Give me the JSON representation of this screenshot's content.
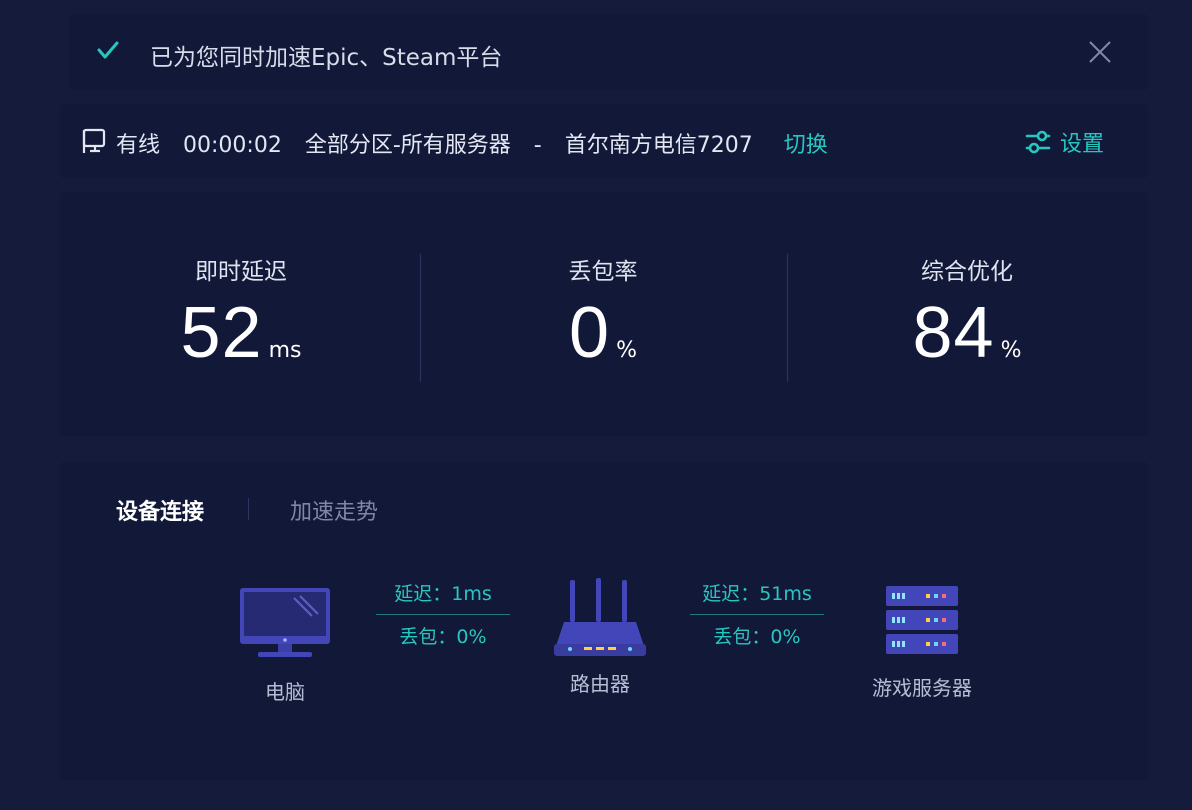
{
  "banner": {
    "message": "已为您同时加速Epic、Steam平台",
    "icons": {
      "check": "check-icon",
      "close": "close-icon"
    }
  },
  "status": {
    "connection_type": "有线",
    "elapsed": "00:00:02",
    "region": "全部分区-所有服务器",
    "separator": "-",
    "server": "首尔南方电信7207",
    "switch_label": "切换",
    "settings_label": "设置"
  },
  "metrics": [
    {
      "label": "即时延迟",
      "value": "52",
      "unit": "ms"
    },
    {
      "label": "丢包率",
      "value": "0",
      "unit": "%"
    },
    {
      "label": "综合优化",
      "value": "84",
      "unit": "%"
    }
  ],
  "tabs": {
    "devices": "设备连接",
    "trend": "加速走势"
  },
  "devices": {
    "pc": "电脑",
    "router": "路由器",
    "server": "游戏服务器"
  },
  "links": [
    {
      "latency": "延迟：1ms",
      "loss": "丢包：0%"
    },
    {
      "latency": "延迟：51ms",
      "loss": "丢包：0%"
    }
  ],
  "colors": {
    "accent": "#27c7c0",
    "background": "#141b3b",
    "device": "#3b3fa6"
  }
}
